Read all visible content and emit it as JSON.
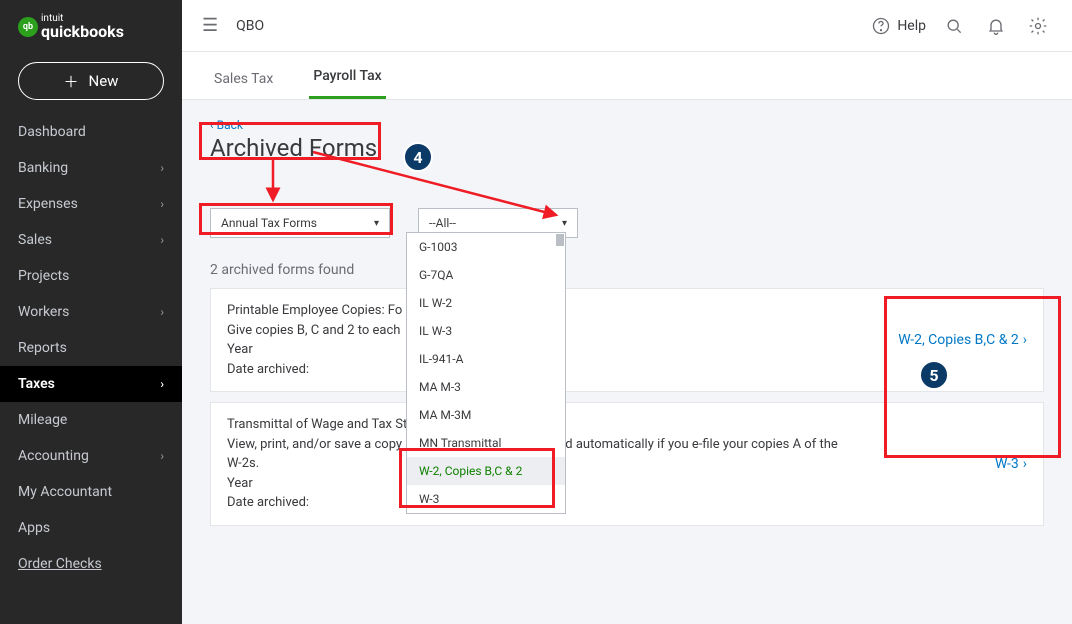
{
  "brand": {
    "top": "intuit",
    "name": "quickbooks",
    "badge": "qb"
  },
  "top": {
    "company": "QBO",
    "help": "Help"
  },
  "new_button": "New",
  "nav": [
    {
      "label": "Dashboard",
      "expand": false
    },
    {
      "label": "Banking",
      "expand": true
    },
    {
      "label": "Expenses",
      "expand": true
    },
    {
      "label": "Sales",
      "expand": true
    },
    {
      "label": "Projects",
      "expand": false
    },
    {
      "label": "Workers",
      "expand": true
    },
    {
      "label": "Reports",
      "expand": false
    },
    {
      "label": "Taxes",
      "expand": true,
      "active": true
    },
    {
      "label": "Mileage",
      "expand": false
    },
    {
      "label": "Accounting",
      "expand": true
    },
    {
      "label": "My Accountant",
      "expand": false
    },
    {
      "label": "Apps",
      "expand": false
    },
    {
      "label": "Order Checks",
      "expand": false,
      "underline": true
    }
  ],
  "tabs": {
    "sales": "Sales Tax",
    "payroll": "Payroll Tax"
  },
  "back": "Back",
  "title": "Archived Forms",
  "filter1": "Annual Tax Forms",
  "filter2": "--All--",
  "dropdown": [
    "G-1003",
    "G-7QA",
    "IL W-2",
    "IL W-3",
    "IL-941-A",
    "MA M-3",
    "MA M-3M",
    "MN Transmittal",
    "W-2, Copies B,C & 2",
    "W-3"
  ],
  "dropdown_selected_index": 8,
  "count": "2 archived forms found",
  "card1": {
    "l1": "Printable Employee Copies: Fo",
    "l2": "Give copies B, C and 2 to each",
    "l3": "Year",
    "l4": "Date archived:",
    "link": "W-2, Copies B,C & 2"
  },
  "card2": {
    "l1": "Transmittal of Wage and Tax St",
    "l2a": "View, print, and/or save a copy",
    "l2b": "e-filed automatically if you e-file your copies A of the",
    "l3": "W-2s.",
    "l4": "Year",
    "l5": "Date archived:",
    "link": "W-3"
  },
  "annotations": {
    "step4": "4",
    "step5": "5"
  }
}
